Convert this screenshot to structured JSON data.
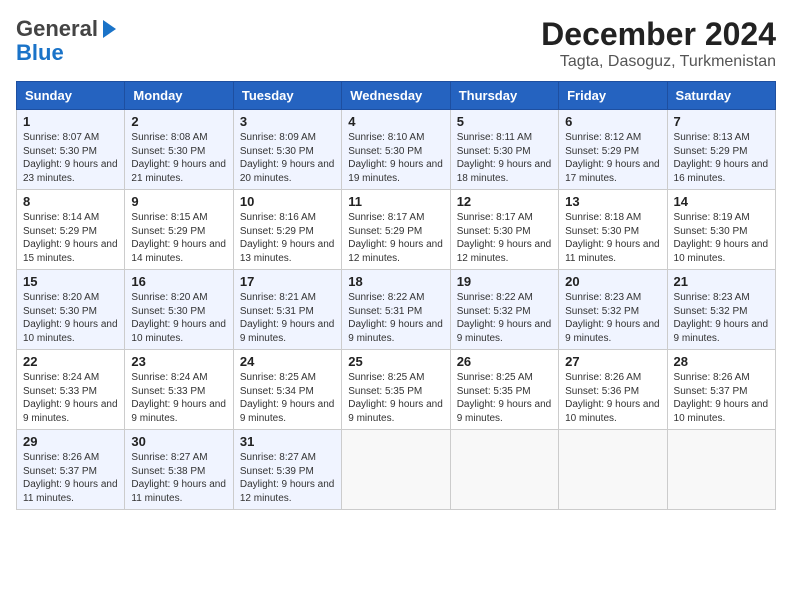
{
  "header": {
    "logo_general": "General",
    "logo_blue": "Blue",
    "title": "December 2024",
    "subtitle": "Tagta, Dasoguz, Turkmenistan"
  },
  "calendar": {
    "days_of_week": [
      "Sunday",
      "Monday",
      "Tuesday",
      "Wednesday",
      "Thursday",
      "Friday",
      "Saturday"
    ],
    "weeks": [
      [
        {
          "day": 1,
          "sunrise": "8:07 AM",
          "sunset": "5:30 PM",
          "daylight": "9 hours and 23 minutes."
        },
        {
          "day": 2,
          "sunrise": "8:08 AM",
          "sunset": "5:30 PM",
          "daylight": "9 hours and 21 minutes."
        },
        {
          "day": 3,
          "sunrise": "8:09 AM",
          "sunset": "5:30 PM",
          "daylight": "9 hours and 20 minutes."
        },
        {
          "day": 4,
          "sunrise": "8:10 AM",
          "sunset": "5:30 PM",
          "daylight": "9 hours and 19 minutes."
        },
        {
          "day": 5,
          "sunrise": "8:11 AM",
          "sunset": "5:30 PM",
          "daylight": "9 hours and 18 minutes."
        },
        {
          "day": 6,
          "sunrise": "8:12 AM",
          "sunset": "5:29 PM",
          "daylight": "9 hours and 17 minutes."
        },
        {
          "day": 7,
          "sunrise": "8:13 AM",
          "sunset": "5:29 PM",
          "daylight": "9 hours and 16 minutes."
        }
      ],
      [
        {
          "day": 8,
          "sunrise": "8:14 AM",
          "sunset": "5:29 PM",
          "daylight": "9 hours and 15 minutes."
        },
        {
          "day": 9,
          "sunrise": "8:15 AM",
          "sunset": "5:29 PM",
          "daylight": "9 hours and 14 minutes."
        },
        {
          "day": 10,
          "sunrise": "8:16 AM",
          "sunset": "5:29 PM",
          "daylight": "9 hours and 13 minutes."
        },
        {
          "day": 11,
          "sunrise": "8:17 AM",
          "sunset": "5:29 PM",
          "daylight": "9 hours and 12 minutes."
        },
        {
          "day": 12,
          "sunrise": "8:17 AM",
          "sunset": "5:30 PM",
          "daylight": "9 hours and 12 minutes."
        },
        {
          "day": 13,
          "sunrise": "8:18 AM",
          "sunset": "5:30 PM",
          "daylight": "9 hours and 11 minutes."
        },
        {
          "day": 14,
          "sunrise": "8:19 AM",
          "sunset": "5:30 PM",
          "daylight": "9 hours and 10 minutes."
        }
      ],
      [
        {
          "day": 15,
          "sunrise": "8:20 AM",
          "sunset": "5:30 PM",
          "daylight": "9 hours and 10 minutes."
        },
        {
          "day": 16,
          "sunrise": "8:20 AM",
          "sunset": "5:30 PM",
          "daylight": "9 hours and 10 minutes."
        },
        {
          "day": 17,
          "sunrise": "8:21 AM",
          "sunset": "5:31 PM",
          "daylight": "9 hours and 9 minutes."
        },
        {
          "day": 18,
          "sunrise": "8:22 AM",
          "sunset": "5:31 PM",
          "daylight": "9 hours and 9 minutes."
        },
        {
          "day": 19,
          "sunrise": "8:22 AM",
          "sunset": "5:32 PM",
          "daylight": "9 hours and 9 minutes."
        },
        {
          "day": 20,
          "sunrise": "8:23 AM",
          "sunset": "5:32 PM",
          "daylight": "9 hours and 9 minutes."
        },
        {
          "day": 21,
          "sunrise": "8:23 AM",
          "sunset": "5:32 PM",
          "daylight": "9 hours and 9 minutes."
        }
      ],
      [
        {
          "day": 22,
          "sunrise": "8:24 AM",
          "sunset": "5:33 PM",
          "daylight": "9 hours and 9 minutes."
        },
        {
          "day": 23,
          "sunrise": "8:24 AM",
          "sunset": "5:33 PM",
          "daylight": "9 hours and 9 minutes."
        },
        {
          "day": 24,
          "sunrise": "8:25 AM",
          "sunset": "5:34 PM",
          "daylight": "9 hours and 9 minutes."
        },
        {
          "day": 25,
          "sunrise": "8:25 AM",
          "sunset": "5:35 PM",
          "daylight": "9 hours and 9 minutes."
        },
        {
          "day": 26,
          "sunrise": "8:25 AM",
          "sunset": "5:35 PM",
          "daylight": "9 hours and 9 minutes."
        },
        {
          "day": 27,
          "sunrise": "8:26 AM",
          "sunset": "5:36 PM",
          "daylight": "9 hours and 10 minutes."
        },
        {
          "day": 28,
          "sunrise": "8:26 AM",
          "sunset": "5:37 PM",
          "daylight": "9 hours and 10 minutes."
        }
      ],
      [
        {
          "day": 29,
          "sunrise": "8:26 AM",
          "sunset": "5:37 PM",
          "daylight": "9 hours and 11 minutes."
        },
        {
          "day": 30,
          "sunrise": "8:27 AM",
          "sunset": "5:38 PM",
          "daylight": "9 hours and 11 minutes."
        },
        {
          "day": 31,
          "sunrise": "8:27 AM",
          "sunset": "5:39 PM",
          "daylight": "9 hours and 12 minutes."
        },
        null,
        null,
        null,
        null
      ]
    ]
  }
}
